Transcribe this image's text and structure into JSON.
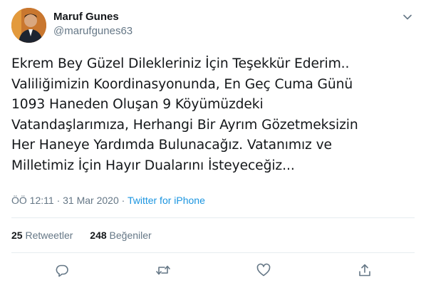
{
  "author": {
    "display_name": "Maruf Gunes",
    "handle": "@marufgunes63"
  },
  "tweet": {
    "text": "Ekrem Bey Güzel Dilekleriniz İçin Teşekkür Ederim..\nValiliğimizin Koordinasyonunda, En Geç Cuma Günü\n1093 Haneden Oluşan 9 Köyümüzdeki\nVatandaşlarımıza, Herhangi Bir Ayrım Gözetmeksizin\nHer Haneye Yardımda Bulunacağız. Vatanımız ve\nMilletimiz İçin Hayır Dualarını İsteyeceğiz...",
    "time": "ÖÖ 12:11",
    "separator": "·",
    "date": "31 Mar 2020",
    "source": "Twitter for iPhone"
  },
  "stats": {
    "retweets_count": "25",
    "retweets_label": "Retweetler",
    "likes_count": "248",
    "likes_label": "Beğeniler"
  },
  "colors": {
    "link": "#1b95e0",
    "muted": "#657786",
    "divider": "#e6ecf0"
  },
  "icons": [
    "chevron-down-icon",
    "reply-icon",
    "retweet-icon",
    "like-icon",
    "share-icon"
  ]
}
